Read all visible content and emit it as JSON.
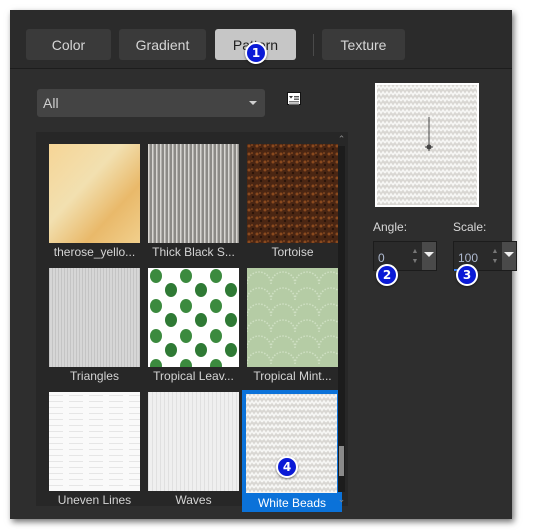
{
  "tabs": [
    {
      "label": "Color",
      "active": false
    },
    {
      "label": "Gradient",
      "active": false
    },
    {
      "label": "Pattern",
      "active": true
    },
    {
      "label": "Texture",
      "active": false
    }
  ],
  "category_dropdown": {
    "selected": "All"
  },
  "view_toggle_icon": "list-view-icon",
  "patterns": [
    {
      "label": "therose_yello...",
      "selected": false
    },
    {
      "label": "Thick Black S...",
      "selected": false
    },
    {
      "label": "Tortoise",
      "selected": false
    },
    {
      "label": "Triangles",
      "selected": false
    },
    {
      "label": "Tropical Leav...",
      "selected": false
    },
    {
      "label": "Tropical Mint...",
      "selected": false
    },
    {
      "label": "Uneven Lines",
      "selected": false
    },
    {
      "label": "Waves",
      "selected": false
    },
    {
      "label": "White Beads",
      "selected": true
    }
  ],
  "scroll_position": 0.95,
  "angle": {
    "label": "Angle:",
    "value": "0"
  },
  "scale": {
    "label": "Scale:",
    "value": "100"
  },
  "callouts": [
    "1",
    "2",
    "3",
    "4"
  ],
  "colors": {
    "accent": "#0b72d9",
    "callout": "#0a1ad6",
    "background": "#2e2e2e"
  }
}
